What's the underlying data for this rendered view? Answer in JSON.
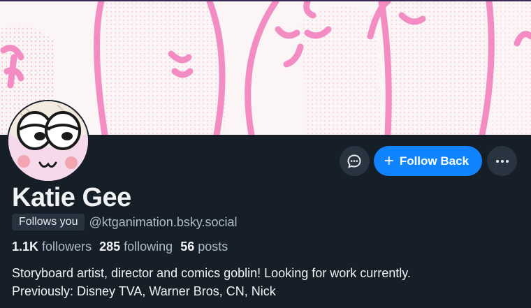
{
  "profile": {
    "display_name": "Katie Gee",
    "follows_you": "Follows you",
    "handle": "@ktganimation.bsky.social",
    "bio_line1": "Storyboard artist, director and comics goblin! Looking for work currently.",
    "bio_line2": "Previously: Disney TVA, Warner Bros, CN, Nick"
  },
  "stats": {
    "followers_count": "1.1K",
    "followers_label": "followers",
    "following_count": "285",
    "following_label": "following",
    "posts_count": "56",
    "posts_label": "posts"
  },
  "actions": {
    "follow_back": "Follow Back",
    "message_icon": "chat-bubble-icon",
    "more_icon": "ellipsis-icon"
  },
  "colors": {
    "background": "#161e27",
    "accent": "#1083fe",
    "banner_pink": "#f48cc4"
  }
}
